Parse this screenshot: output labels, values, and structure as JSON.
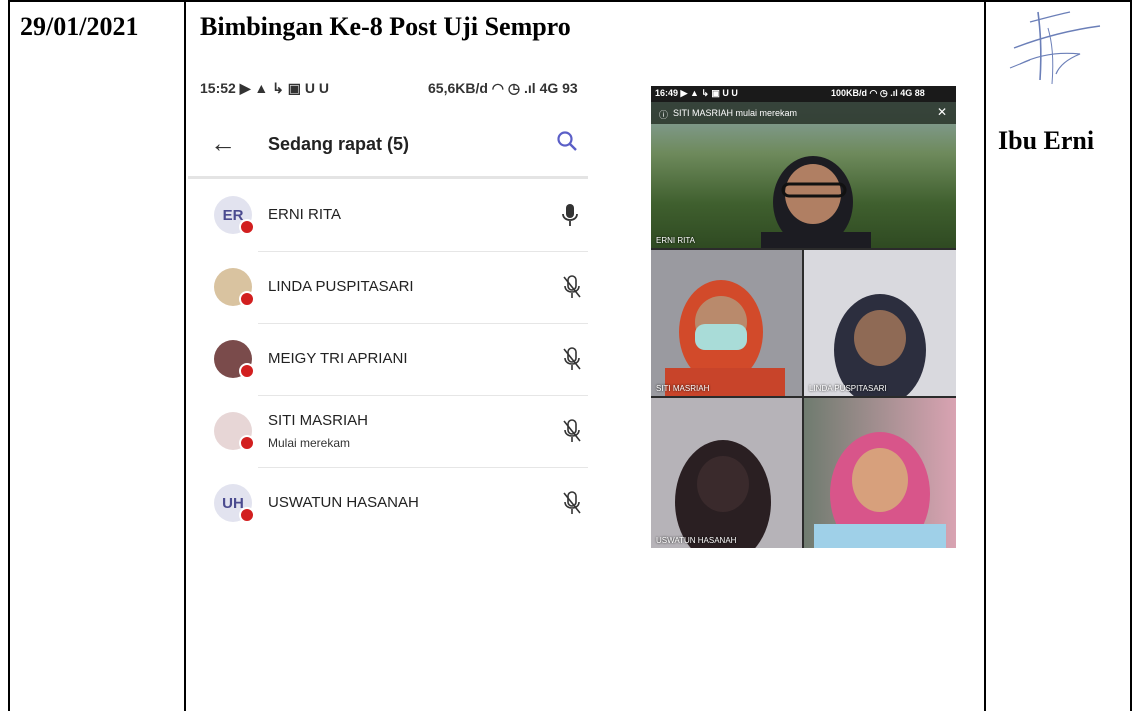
{
  "row": {
    "date": "29/01/2021",
    "activity": "Bimbingan Ke-8 Post Uji Sempro",
    "signer": "Ibu Erni"
  },
  "screenshot1": {
    "status_left": "15:52 ▶ ▲ ↳ ▣ U U",
    "status_right": "65,6KB/d ◠ ◷ .ıl 4G 93",
    "title": "Sedang rapat (5)",
    "participants": [
      {
        "initials": "ER",
        "name": "ERNI RITA",
        "sub": "",
        "mic": "on"
      },
      {
        "initials": "",
        "name": "LINDA PUSPITASARI",
        "sub": "",
        "mic": "off"
      },
      {
        "initials": "",
        "name": "MEIGY TRI APRIANI",
        "sub": "",
        "mic": "off"
      },
      {
        "initials": "",
        "name": "SITI MASRIAH",
        "sub": "Mulai merekam",
        "mic": "off"
      },
      {
        "initials": "UH",
        "name": "USWATUN HASANAH",
        "sub": "",
        "mic": "off"
      }
    ]
  },
  "screenshot2": {
    "status_left": "16:49 ▶ ▲ ↳ ▣ U U",
    "status_right": "100KB/d ◠ ◷ .ıl 4G 88",
    "banner": "SITI MASRIAH mulai merekam",
    "tiles": [
      "ERNI RITA",
      "SITI MASRIAH",
      "LINDA PUSPITASARI",
      "USWATUN HASANAH"
    ]
  },
  "colors": {
    "record_dot": "#d21f1f",
    "accent": "#5b5fc7"
  }
}
